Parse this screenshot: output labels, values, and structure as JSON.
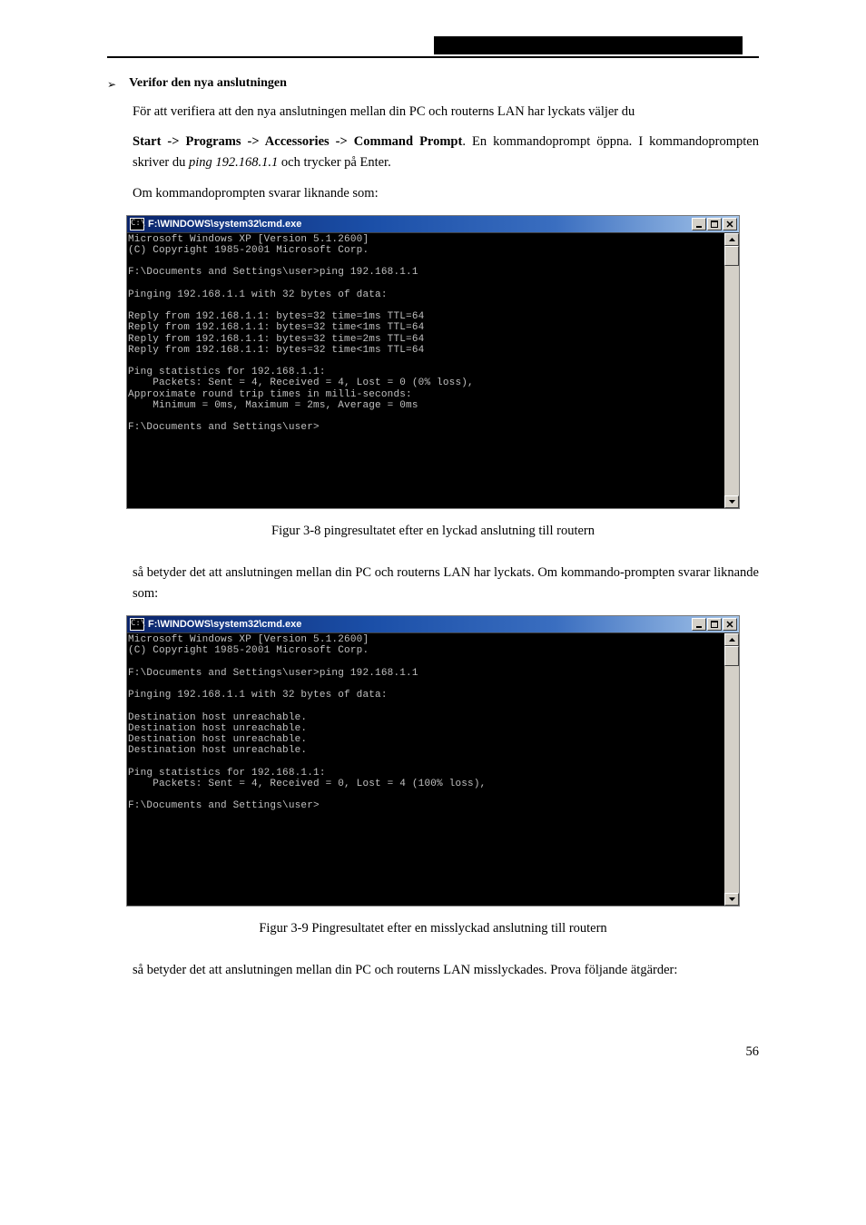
{
  "header_blackbar": "",
  "section_bullet": {
    "title": "Verifor den nya anslutningen"
  },
  "p1": "För att verifiera att den nya anslutningen mellan din PC och routerns LAN har lyckats väljer du",
  "p2a": "Start -> Programs -> Accessories -> Command Prompt",
  "p2b": ". En kommandoprompt öppna. I kommandoprompten skriver du",
  "p2c": "ping 192.168.1.1",
  "p2d": " och trycker på Enter.",
  "p3": "Om kommandoprompten svarar liknande som:",
  "caption1": "Figur 3-8 pingresultatet efter en lyckad anslutning till routern",
  "p4a": "så betyder det att anslutningen mellan din PC och routerns LAN har lyckats. Om kommando-prompten svarar liknande som:",
  "caption2": "Figur 3-9 Pingresultatet efter en misslyckad anslutning till routern",
  "p5": "så betyder det att anslutningen mellan din PC och routerns LAN misslyckades. Prova följande ätgärder:",
  "pagenum": "56",
  "cmd": {
    "title": "F:\\WINDOWS\\system32\\cmd.exe",
    "icon_text": "C:\\",
    "success_lines": "Microsoft Windows XP [Version 5.1.2600]\n(C) Copyright 1985-2001 Microsoft Corp.\n\nF:\\Documents and Settings\\user>ping 192.168.1.1\n\nPinging 192.168.1.1 with 32 bytes of data:\n\nReply from 192.168.1.1: bytes=32 time=1ms TTL=64\nReply from 192.168.1.1: bytes=32 time<1ms TTL=64\nReply from 192.168.1.1: bytes=32 time=2ms TTL=64\nReply from 192.168.1.1: bytes=32 time<1ms TTL=64\n\nPing statistics for 192.168.1.1:\n    Packets: Sent = 4, Received = 4, Lost = 0 (0% loss),\nApproximate round trip times in milli-seconds:\n    Minimum = 0ms, Maximum = 2ms, Average = 0ms\n\nF:\\Documents and Settings\\user>",
    "fail_lines": "Microsoft Windows XP [Version 5.1.2600]\n(C) Copyright 1985-2001 Microsoft Corp.\n\nF:\\Documents and Settings\\user>ping 192.168.1.1\n\nPinging 192.168.1.1 with 32 bytes of data:\n\nDestination host unreachable.\nDestination host unreachable.\nDestination host unreachable.\nDestination host unreachable.\n\nPing statistics for 192.168.1.1:\n    Packets: Sent = 4, Received = 0, Lost = 4 (100% loss),\n\nF:\\Documents and Settings\\user>"
  }
}
